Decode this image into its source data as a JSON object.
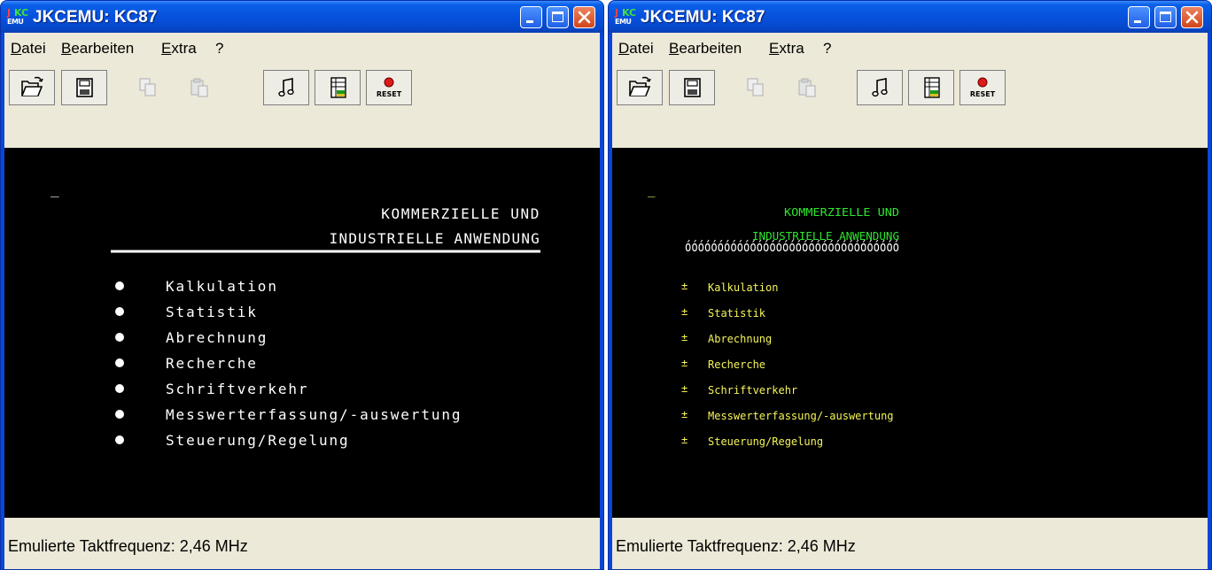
{
  "windows": [
    {
      "title": "JKCEMU: KC87",
      "menu": [
        "Datei",
        "Bearbeiten",
        "Extra",
        "?"
      ],
      "toolbar": [
        {
          "icon": "open-folder-icon",
          "enabled": true
        },
        {
          "icon": "floppy-save-icon",
          "enabled": true
        },
        {
          "icon": "copy-icon",
          "enabled": false
        },
        {
          "icon": "paste-icon",
          "enabled": false
        },
        {
          "icon": "music-note-icon",
          "enabled": true
        },
        {
          "icon": "memory-editor-icon",
          "enabled": true
        },
        {
          "icon": "reset-icon",
          "enabled": true,
          "label": "RESET"
        }
      ],
      "screen": {
        "cursor": "_",
        "heading1": "KOMMERZIELLE UND",
        "heading2": "INDUSTRIELLE ANWENDUNG",
        "items": [
          "Kalkulation",
          "Statistik",
          "Abrechnung",
          "Recherche",
          "Schriftverkehr",
          "Messwerterfassung/-auswertung",
          "Steuerung/Regelung"
        ]
      },
      "status": "Emulierte Taktfrequenz: 2,46 MHz"
    },
    {
      "title": "JKCEMU: KC87",
      "menu": [
        "Datei",
        "Bearbeiten",
        "Extra",
        "?"
      ],
      "toolbar": [
        {
          "icon": "open-folder-icon",
          "enabled": true
        },
        {
          "icon": "floppy-save-icon",
          "enabled": true
        },
        {
          "icon": "copy-icon",
          "enabled": false
        },
        {
          "icon": "paste-icon",
          "enabled": false
        },
        {
          "icon": "music-note-icon",
          "enabled": true
        },
        {
          "icon": "memory-editor-icon",
          "enabled": true
        },
        {
          "icon": "reset-icon",
          "enabled": true,
          "label": "RESET"
        }
      ],
      "screen": {
        "cursor": "_",
        "heading1": "KOMMERZIELLE UND",
        "heading2": "INDUSTRIELLE ANWENDUNG",
        "underline_glyphs": "óóóóóóóóóóóóóóóóóóóóóóóóóóóóóóóóó",
        "bullet_glyph": "±",
        "items": [
          "Kalkulation",
          "Statistik",
          "Abrechnung",
          "Recherche",
          "Schriftverkehr",
          "Messwerterfassung/-auswertung",
          "Steuerung/Regelung"
        ]
      },
      "status": "Emulierte Taktfrequenz: 2,46 MHz"
    }
  ],
  "app_icon": {
    "top": "JKC",
    "bottom": "EMU"
  },
  "colors": {
    "titlebar": "#0650dc",
    "window_body": "#ece9d8",
    "screen_bg": "#000000",
    "screen_white": "#ffffff",
    "screen_green": "#2ee62e",
    "screen_yellow": "#f4f45a"
  }
}
